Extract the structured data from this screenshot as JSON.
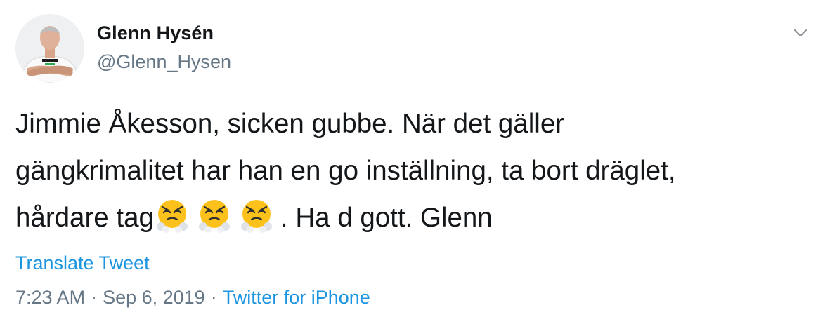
{
  "author": {
    "display_name": "Glenn Hysén",
    "handle": "@Glenn_Hysen",
    "avatar_icon": "profile-photo"
  },
  "tweet": {
    "lines": [
      "Jimmie Åkesson, sicken gubbe. När det gäller",
      "gängkrimalitet har han en go inställning, ta bort dräglet,",
      "hårdare tag"
    ],
    "after_emoji": ". Ha d gott. Glenn",
    "emoji_icon": "face-with-steam-from-nose-icon",
    "emoji_count": 3
  },
  "actions": {
    "translate_label": "Translate Tweet",
    "menu_icon": "chevron-down-icon"
  },
  "meta": {
    "time": "7:23 AM",
    "separator": "·",
    "date": "Sep 6, 2019",
    "source": "Twitter for iPhone"
  },
  "colors": {
    "link": "#1b95e0",
    "secondary_text": "#657786",
    "primary_text": "#14171a"
  }
}
